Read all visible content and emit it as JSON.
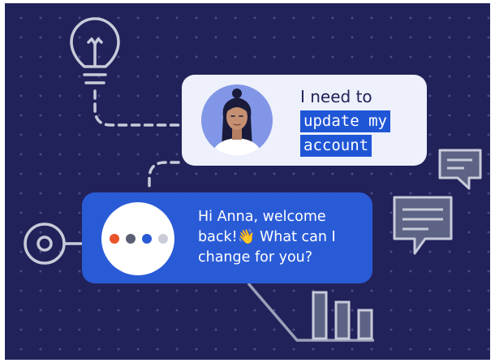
{
  "user_message": {
    "line1": "I need to",
    "highlight_line1": "update my",
    "highlight_line2": "account"
  },
  "bot_message": {
    "text": "Hi Anna, welcome back!👋 What can I change for you?"
  },
  "typing_dot_colors": [
    "#e8532a",
    "#5a5f73",
    "#2a5bd7",
    "#c9ccd6"
  ],
  "icons": [
    "lightbulb-icon",
    "target-icon",
    "chat-icon",
    "bar-chart-icon",
    "avatar-icon"
  ],
  "colors": {
    "background": "#22225a",
    "user_bubble": "#eef0fb",
    "bot_bubble": "#2a5bd7",
    "highlight": "#1f56d6"
  }
}
